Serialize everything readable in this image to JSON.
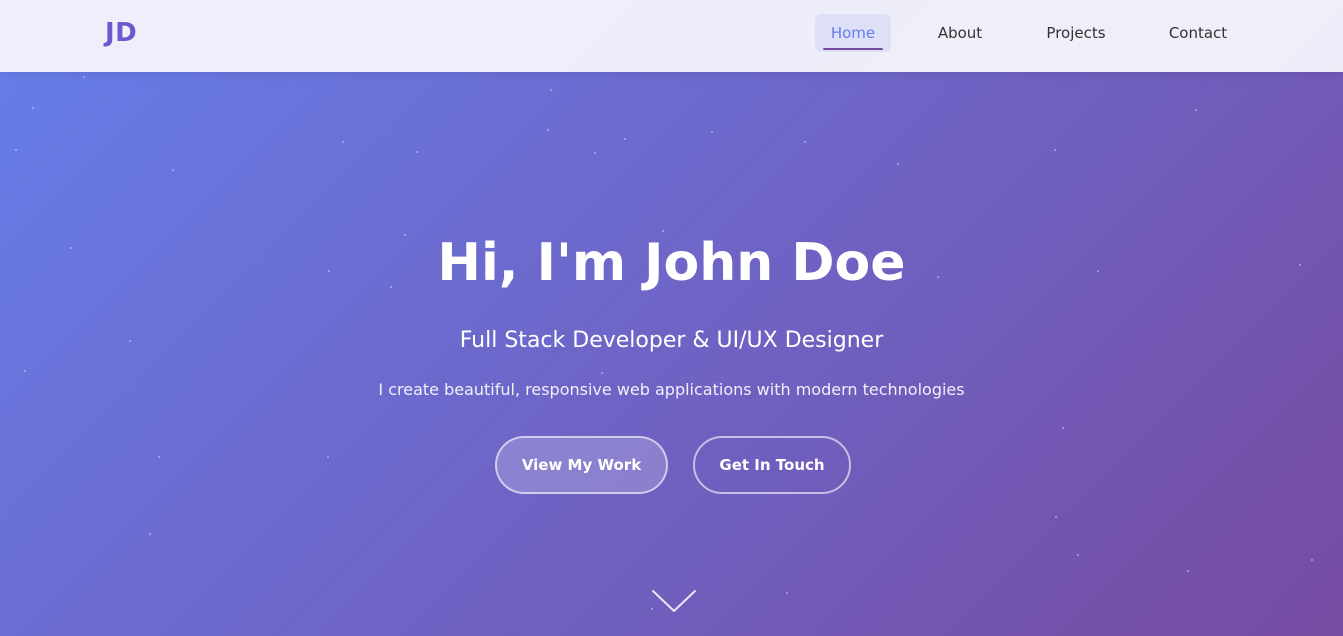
{
  "navbar": {
    "logo": "JD",
    "links": [
      {
        "label": "Home",
        "active": true
      },
      {
        "label": "About",
        "active": false
      },
      {
        "label": "Projects",
        "active": false
      },
      {
        "label": "Contact",
        "active": false
      }
    ]
  },
  "hero": {
    "title": "Hi, I'm John Doe",
    "subtitle": "Full Stack Developer & UI/UX Designer",
    "description": "I create beautiful, responsive web applications with modern technologies",
    "primary_button": "View My Work",
    "secondary_button": "Get In Touch",
    "scroll_icon": "chevron-down-icon"
  },
  "colors": {
    "gradient_start": "#667eea",
    "gradient_end": "#764ba2",
    "logo": "#6a5acd",
    "active_link": "#667eea"
  }
}
